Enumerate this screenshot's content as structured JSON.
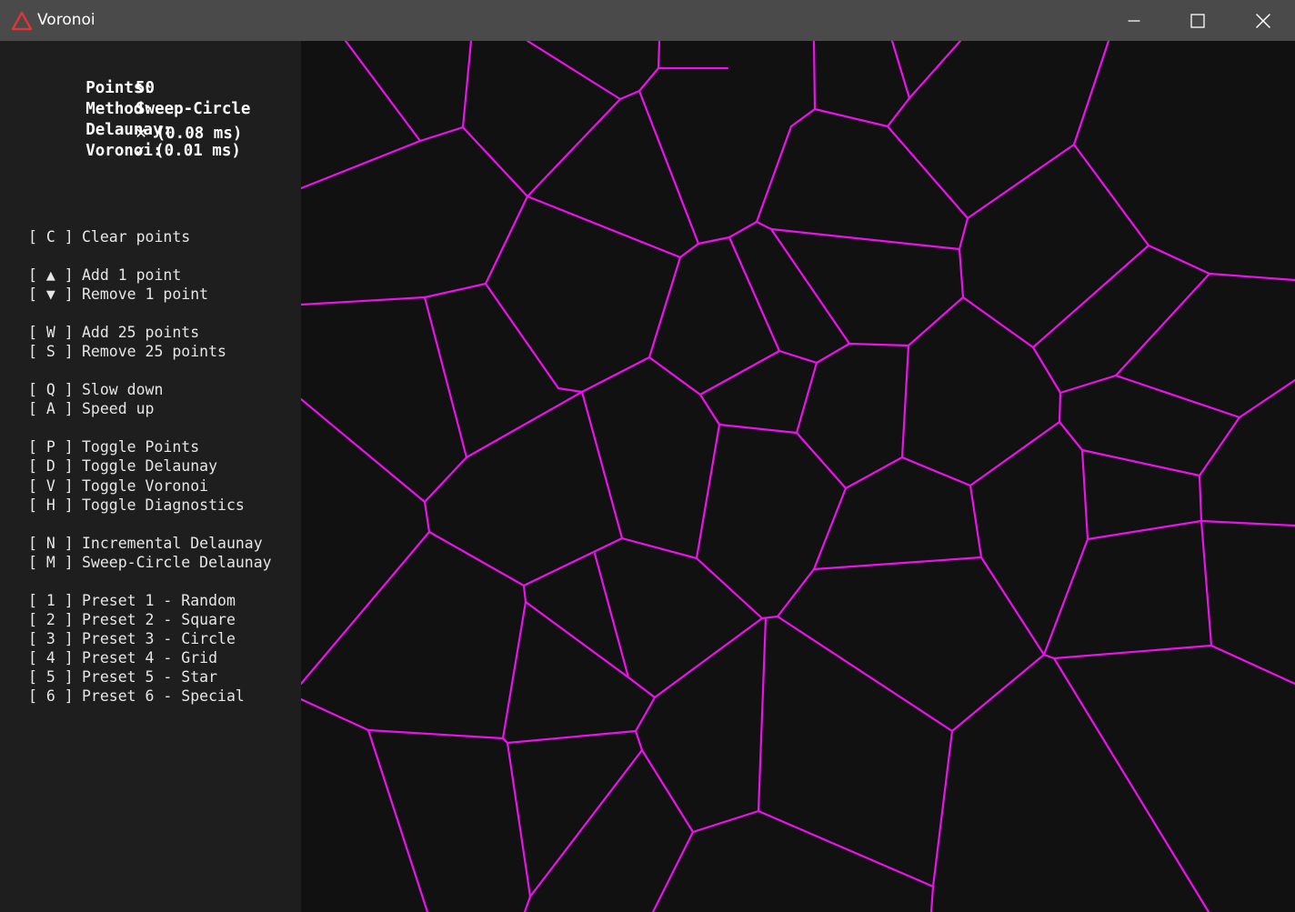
{
  "window": {
    "title": "Voronoi",
    "icon": "red-triangle-icon",
    "controls": [
      "minimize-icon",
      "maximize-icon",
      "close-icon"
    ]
  },
  "stats": {
    "points": {
      "label": "Points:",
      "value": "50"
    },
    "method": {
      "label": "Method:",
      "value": "Sweep-Circle"
    },
    "delaunay": {
      "label": "Delaunay:",
      "status": "✕",
      "time": "(0.08 ms)"
    },
    "voronoi": {
      "label": "Voronoi:",
      "status": "✓",
      "time": "(0.01 ms)"
    }
  },
  "controls": [
    {
      "key": "[ C ]",
      "action": "Clear points"
    },
    {
      "key": "[ ▲ ]",
      "action": "Add 1 point"
    },
    {
      "key": "[ ▼ ]",
      "action": "Remove 1 point"
    },
    {
      "key": "[ W ]",
      "action": "Add 25 points"
    },
    {
      "key": "[ S ]",
      "action": "Remove 25 points"
    },
    {
      "key": "[ Q ]",
      "action": "Slow down"
    },
    {
      "key": "[ A ]",
      "action": "Speed up"
    },
    {
      "key": "[ P ]",
      "action": "Toggle Points"
    },
    {
      "key": "[ D ]",
      "action": "Toggle Delaunay"
    },
    {
      "key": "[ V ]",
      "action": "Toggle Voronoi"
    },
    {
      "key": "[ H ]",
      "action": "Toggle Diagnostics"
    },
    {
      "key": "[ N ]",
      "action": "Incremental Delaunay"
    },
    {
      "key": "[ M ]",
      "action": "Sweep-Circle Delaunay"
    },
    {
      "key": "[ 1 ]",
      "action": "Preset 1 - Random"
    },
    {
      "key": "[ 2 ]",
      "action": "Preset 2 - Square"
    },
    {
      "key": "[ 3 ]",
      "action": "Preset 3 - Circle"
    },
    {
      "key": "[ 4 ]",
      "action": "Preset 4 - Grid"
    },
    {
      "key": "[ 5 ]",
      "action": "Preset 5 - Star"
    },
    {
      "key": "[ 6 ]",
      "action": "Preset 6 - Special"
    }
  ],
  "colors": {
    "titlebar": "#4a4a4a",
    "sidebar": "#1e1e1e",
    "canvas": "#111111",
    "voronoi_edge": "#ee10ee",
    "text": "#ffffff"
  }
}
